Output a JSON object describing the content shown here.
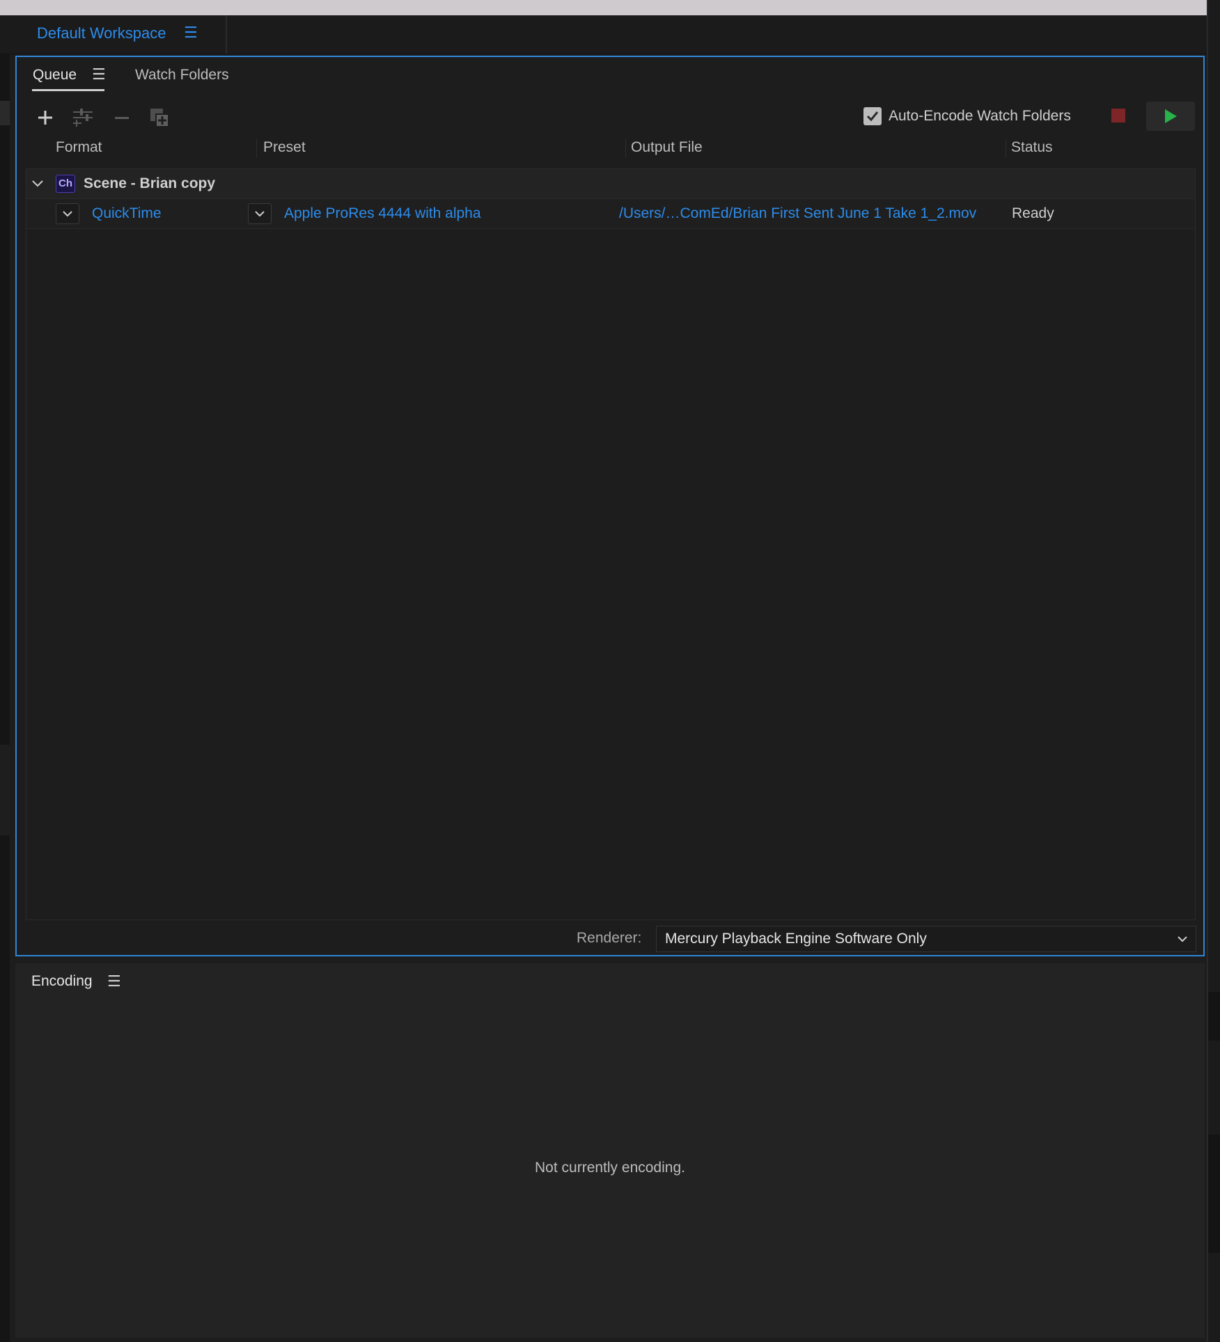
{
  "workspace": {
    "title": "Default Workspace"
  },
  "tabs": [
    {
      "label": "Queue",
      "active": true
    },
    {
      "label": "Watch Folders",
      "active": false
    }
  ],
  "toolbar": {
    "auto_encode_label": "Auto-Encode Watch Folders",
    "auto_encode_checked": true
  },
  "columns": [
    "Format",
    "Preset",
    "Output File",
    "Status"
  ],
  "queue": {
    "group": {
      "badge": "Ch",
      "name": "Scene - Brian copy",
      "item": {
        "format": "QuickTime",
        "preset": "Apple ProRes 4444 with alpha",
        "output": "/Users/…ComEd/Brian First Sent June 1 Take  1_2.mov",
        "status": "Ready"
      }
    }
  },
  "renderer": {
    "label": "Renderer:",
    "value": "Mercury Playback Engine Software Only"
  },
  "encoding": {
    "title": "Encoding",
    "message": "Not currently encoding."
  },
  "colors": {
    "accent": "#2d8ceb",
    "focus_border": "#2f86d9",
    "stop": "#7d2527",
    "start": "#27b34a",
    "background": "#1d1d1d"
  },
  "icons": [
    "menu-icon",
    "add-icon",
    "settings-icon",
    "remove-icon",
    "duplicate-icon",
    "checkbox-icon",
    "stop-icon",
    "play-icon",
    "chevron-down-icon"
  ]
}
